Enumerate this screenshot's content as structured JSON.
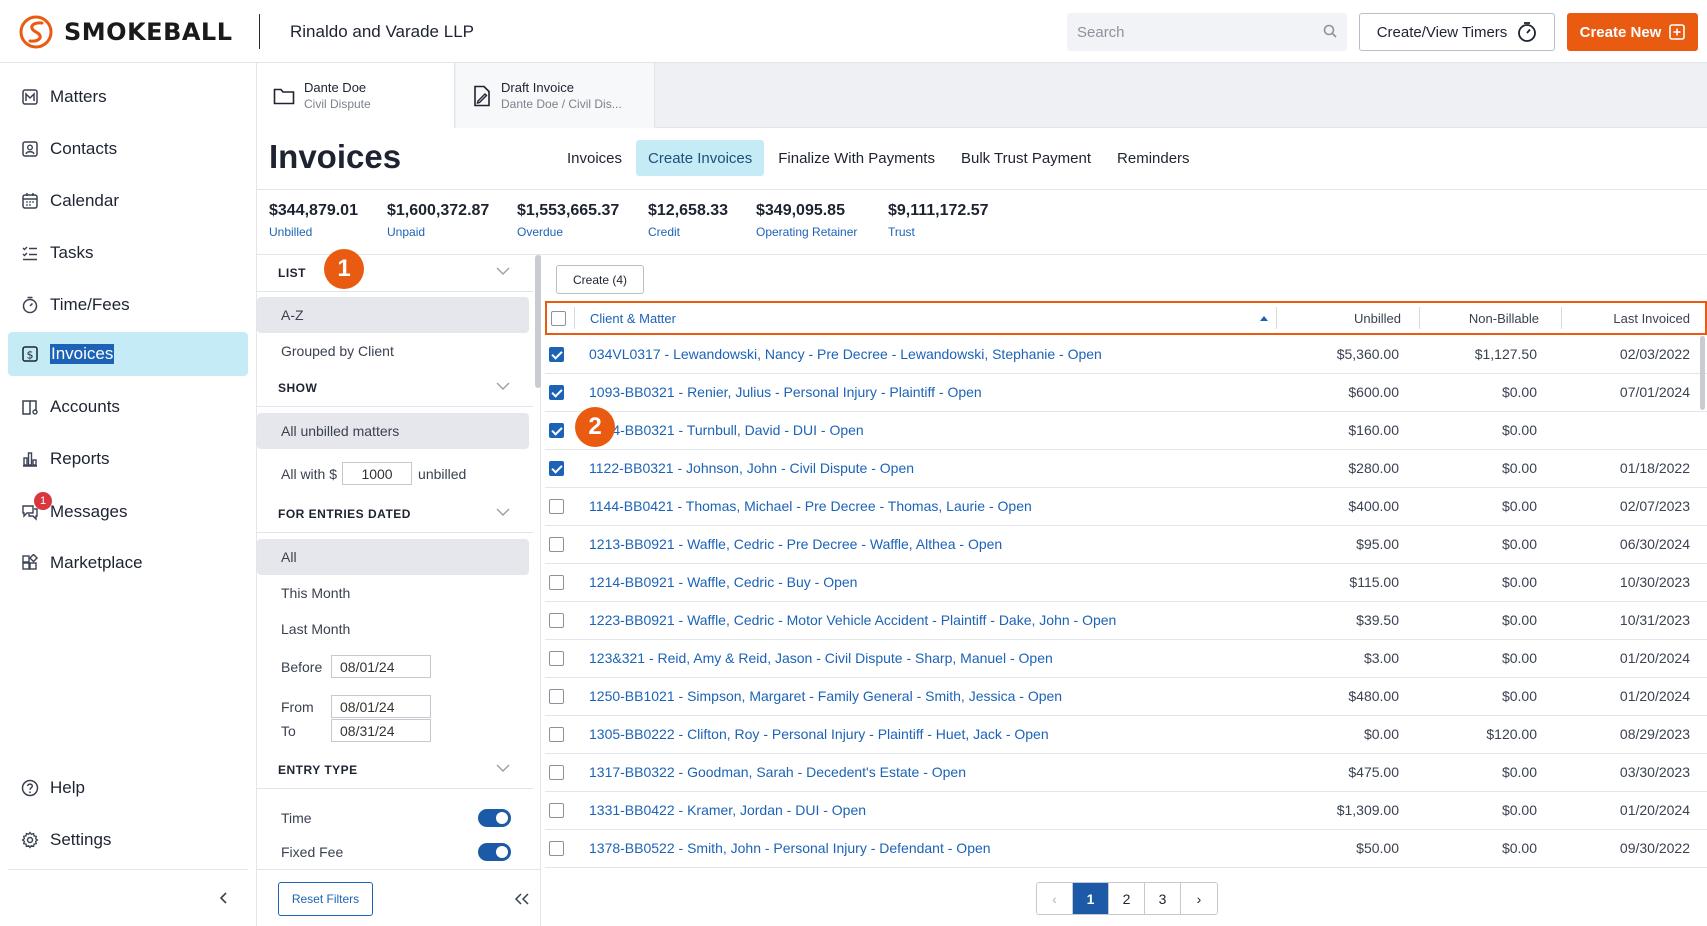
{
  "app": {
    "brand": "SMOKEBALL",
    "firm_name": "Rinaldo and Varade LLP",
    "search_placeholder": "Search",
    "timers_label": "Create/View Timers",
    "create_new_label": "Create New",
    "brand_color": "#ea5b12",
    "link_color": "#1c63b7"
  },
  "nav": {
    "items": [
      {
        "label": "Matters",
        "icon": "matters-icon"
      },
      {
        "label": "Contacts",
        "icon": "contacts-icon"
      },
      {
        "label": "Calendar",
        "icon": "calendar-icon"
      },
      {
        "label": "Tasks",
        "icon": "tasks-icon"
      },
      {
        "label": "Time/Fees",
        "icon": "stopwatch-icon"
      },
      {
        "label": "Invoices",
        "icon": "invoice-icon",
        "active": true
      },
      {
        "label": "Accounts",
        "icon": "accounts-icon"
      },
      {
        "label": "Reports",
        "icon": "reports-icon"
      },
      {
        "label": "Messages",
        "icon": "messages-icon",
        "badge": "1"
      },
      {
        "label": "Marketplace",
        "icon": "marketplace-icon"
      }
    ],
    "help_label": "Help",
    "settings_label": "Settings"
  },
  "matter_tabs": [
    {
      "title": "Dante Doe",
      "subtitle": "Civil Dispute",
      "icon": "folder-icon"
    },
    {
      "title": "Draft Invoice",
      "subtitle": "Dante Doe / Civil Dis...",
      "icon": "document-icon"
    }
  ],
  "page": {
    "title": "Invoices",
    "tabs": [
      "Invoices",
      "Create Invoices",
      "Finalize With Payments",
      "Bulk Trust Payment",
      "Reminders"
    ],
    "active_tab": "Create Invoices"
  },
  "stats": [
    {
      "value": "$344,879.01",
      "label": "Unbilled"
    },
    {
      "value": "$1,600,372.87",
      "label": "Unpaid"
    },
    {
      "value": "$1,553,665.37",
      "label": "Overdue"
    },
    {
      "value": "$12,658.33",
      "label": "Credit"
    },
    {
      "value": "$349,095.85",
      "label": "Operating Retainer"
    },
    {
      "value": "$9,111,172.57",
      "label": "Trust"
    }
  ],
  "filters": {
    "list_title": "LIST",
    "list_options": [
      "A-Z",
      "Grouped by Client"
    ],
    "show_title": "SHOW",
    "show_all": "All unbilled matters",
    "show_with_prefix": "All with $",
    "show_with_amount": "1000",
    "show_with_suffix": "unbilled",
    "dated_title": "FOR ENTRIES DATED",
    "dated_options": [
      "All",
      "This Month",
      "Last Month"
    ],
    "before_label": "Before",
    "before_value": "08/01/24",
    "from_label": "From",
    "from_value": "08/01/24",
    "to_label": "To",
    "to_value": "08/31/24",
    "entry_type_title": "ENTRY TYPE",
    "entry_types": [
      {
        "label": "Time",
        "on": true
      },
      {
        "label": "Fixed Fee",
        "on": true
      }
    ],
    "reset_label": "Reset Filters"
  },
  "callouts": [
    "1",
    "2"
  ],
  "table": {
    "create_label": "Create (4)",
    "columns": {
      "matter": "Client & Matter",
      "unbilled": "Unbilled",
      "nonbillable": "Non-Billable",
      "last_invoiced": "Last Invoiced"
    },
    "rows": [
      {
        "checked": true,
        "matter": "034VL0317 - Lewandowski, Nancy - Pre Decree - Lewandowski, Stephanie - Open",
        "unbilled": "$5,360.00",
        "nonbillable": "$1,127.50",
        "last_invoiced": "02/03/2022"
      },
      {
        "checked": true,
        "matter": "1093-BB0321 - Renier, Julius - Personal Injury - Plaintiff - Open",
        "unbilled": "$600.00",
        "nonbillable": "$0.00",
        "last_invoiced": "07/01/2024"
      },
      {
        "checked": true,
        "matter": "1094-BB0321 - Turnbull, David - DUI - Open",
        "unbilled": "$160.00",
        "nonbillable": "$0.00",
        "last_invoiced": ""
      },
      {
        "checked": true,
        "matter": "1122-BB0321 - Johnson, John - Civil Dispute - Open",
        "unbilled": "$280.00",
        "nonbillable": "$0.00",
        "last_invoiced": "01/18/2022"
      },
      {
        "checked": false,
        "matter": "1144-BB0421 - Thomas, Michael - Pre Decree - Thomas, Laurie - Open",
        "unbilled": "$400.00",
        "nonbillable": "$0.00",
        "last_invoiced": "02/07/2023"
      },
      {
        "checked": false,
        "matter": "1213-BB0921 - Waffle, Cedric - Pre Decree - Waffle, Althea - Open",
        "unbilled": "$95.00",
        "nonbillable": "$0.00",
        "last_invoiced": "06/30/2024"
      },
      {
        "checked": false,
        "matter": "1214-BB0921 - Waffle, Cedric - Buy - Open",
        "unbilled": "$115.00",
        "nonbillable": "$0.00",
        "last_invoiced": "10/30/2023"
      },
      {
        "checked": false,
        "matter": "1223-BB0921 - Waffle, Cedric - Motor Vehicle Accident - Plaintiff - Dake, John - Open",
        "unbilled": "$39.50",
        "nonbillable": "$0.00",
        "last_invoiced": "10/31/2023"
      },
      {
        "checked": false,
        "matter": "123&321 - Reid, Amy & Reid, Jason - Civil Dispute - Sharp, Manuel - Open",
        "unbilled": "$3.00",
        "nonbillable": "$0.00",
        "last_invoiced": "01/20/2024"
      },
      {
        "checked": false,
        "matter": "1250-BB1021 - Simpson, Margaret - Family General - Smith, Jessica - Open",
        "unbilled": "$480.00",
        "nonbillable": "$0.00",
        "last_invoiced": "01/20/2024"
      },
      {
        "checked": false,
        "matter": "1305-BB0222 - Clifton, Roy - Personal Injury - Plaintiff - Huet, Jack - Open",
        "unbilled": "$0.00",
        "nonbillable": "$120.00",
        "last_invoiced": "08/29/2023"
      },
      {
        "checked": false,
        "matter": "1317-BB0322 - Goodman, Sarah - Decedent's Estate - Open",
        "unbilled": "$475.00",
        "nonbillable": "$0.00",
        "last_invoiced": "03/30/2023"
      },
      {
        "checked": false,
        "matter": "1331-BB0422 - Kramer, Jordan - DUI - Open",
        "unbilled": "$1,309.00",
        "nonbillable": "$0.00",
        "last_invoiced": "01/20/2024"
      },
      {
        "checked": false,
        "matter": "1378-BB0522 - Smith, John - Personal Injury - Defendant - Open",
        "unbilled": "$50.00",
        "nonbillable": "$0.00",
        "last_invoiced": "09/30/2022"
      }
    ]
  },
  "pagination": {
    "prev": "‹",
    "pages": [
      "1",
      "2",
      "3"
    ],
    "current": "1",
    "next": "›"
  }
}
